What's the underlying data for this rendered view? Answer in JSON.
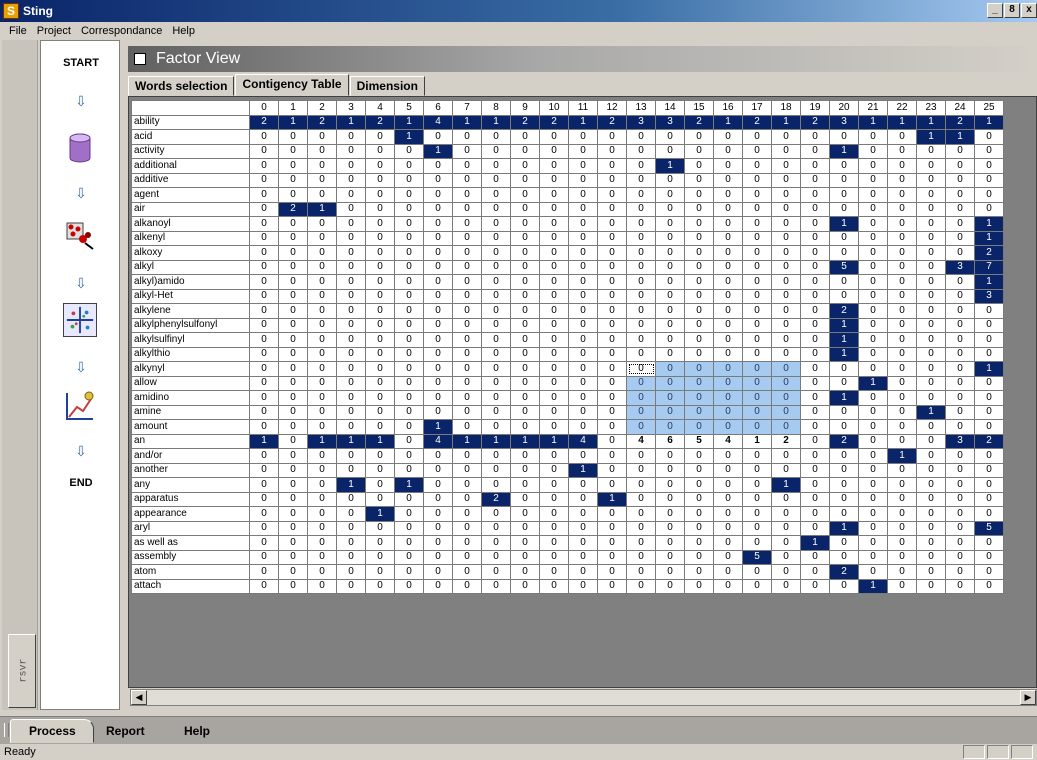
{
  "window": {
    "title": "Sting",
    "app_icon": "S",
    "minimize": "_",
    "restore": "8",
    "close": "x"
  },
  "menu": [
    "File",
    "Project",
    "Correspondance",
    "Help"
  ],
  "process": {
    "start": "START",
    "end": "END",
    "side_tab": "rsvr",
    "icons": [
      "database-icon",
      "sort-filter-icon",
      "factor-grid-icon",
      "chart-icon"
    ]
  },
  "factor_view": {
    "title": "Factor View"
  },
  "tabs": [
    {
      "label": "Words selection"
    },
    {
      "label": "Contigency Table",
      "active": true
    },
    {
      "label": "Dimension"
    }
  ],
  "table": {
    "columns": [
      "0",
      "1",
      "2",
      "3",
      "4",
      "5",
      "6",
      "7",
      "8",
      "9",
      "10",
      "11",
      "12",
      "13",
      "14",
      "15",
      "16",
      "17",
      "18",
      "19",
      "20",
      "21",
      "22",
      "23",
      "24",
      "25"
    ],
    "rows": [
      {
        "word": "ability",
        "values": [
          2,
          1,
          2,
          1,
          2,
          1,
          4,
          1,
          1,
          2,
          2,
          1,
          2,
          3,
          3,
          2,
          1,
          2,
          1,
          2,
          3,
          1,
          1,
          1,
          2,
          1
        ]
      },
      {
        "word": "acid",
        "values": [
          0,
          0,
          0,
          0,
          0,
          1,
          0,
          0,
          0,
          0,
          0,
          0,
          0,
          0,
          0,
          0,
          0,
          0,
          0,
          0,
          0,
          0,
          0,
          1,
          1,
          0
        ]
      },
      {
        "word": "activity",
        "values": [
          0,
          0,
          0,
          0,
          0,
          0,
          1,
          0,
          0,
          0,
          0,
          0,
          0,
          0,
          0,
          0,
          0,
          0,
          0,
          0,
          1,
          0,
          0,
          0,
          0,
          0
        ]
      },
      {
        "word": "additional",
        "values": [
          0,
          0,
          0,
          0,
          0,
          0,
          0,
          0,
          0,
          0,
          0,
          0,
          0,
          0,
          1,
          0,
          0,
          0,
          0,
          0,
          0,
          0,
          0,
          0,
          0,
          0
        ]
      },
      {
        "word": "additive",
        "values": [
          0,
          0,
          0,
          0,
          0,
          0,
          0,
          0,
          0,
          0,
          0,
          0,
          0,
          0,
          0,
          0,
          0,
          0,
          0,
          0,
          0,
          0,
          0,
          0,
          0,
          0
        ]
      },
      {
        "word": "agent",
        "values": [
          0,
          0,
          0,
          0,
          0,
          0,
          0,
          0,
          0,
          0,
          0,
          0,
          0,
          0,
          0,
          0,
          0,
          0,
          0,
          0,
          0,
          0,
          0,
          0,
          0,
          0
        ]
      },
      {
        "word": "air",
        "values": [
          0,
          2,
          1,
          0,
          0,
          0,
          0,
          0,
          0,
          0,
          0,
          0,
          0,
          0,
          0,
          0,
          0,
          0,
          0,
          0,
          0,
          0,
          0,
          0,
          0,
          0
        ]
      },
      {
        "word": "alkanoyl",
        "values": [
          0,
          0,
          0,
          0,
          0,
          0,
          0,
          0,
          0,
          0,
          0,
          0,
          0,
          0,
          0,
          0,
          0,
          0,
          0,
          0,
          1,
          0,
          0,
          0,
          0,
          1
        ]
      },
      {
        "word": "alkenyl",
        "values": [
          0,
          0,
          0,
          0,
          0,
          0,
          0,
          0,
          0,
          0,
          0,
          0,
          0,
          0,
          0,
          0,
          0,
          0,
          0,
          0,
          0,
          0,
          0,
          0,
          0,
          1
        ]
      },
      {
        "word": "alkoxy",
        "values": [
          0,
          0,
          0,
          0,
          0,
          0,
          0,
          0,
          0,
          0,
          0,
          0,
          0,
          0,
          0,
          0,
          0,
          0,
          0,
          0,
          0,
          0,
          0,
          0,
          0,
          2
        ]
      },
      {
        "word": "alkyl",
        "values": [
          0,
          0,
          0,
          0,
          0,
          0,
          0,
          0,
          0,
          0,
          0,
          0,
          0,
          0,
          0,
          0,
          0,
          0,
          0,
          0,
          5,
          0,
          0,
          0,
          3,
          7
        ]
      },
      {
        "word": "alkyl)amido",
        "values": [
          0,
          0,
          0,
          0,
          0,
          0,
          0,
          0,
          0,
          0,
          0,
          0,
          0,
          0,
          0,
          0,
          0,
          0,
          0,
          0,
          0,
          0,
          0,
          0,
          0,
          1
        ]
      },
      {
        "word": "alkyl-Het",
        "values": [
          0,
          0,
          0,
          0,
          0,
          0,
          0,
          0,
          0,
          0,
          0,
          0,
          0,
          0,
          0,
          0,
          0,
          0,
          0,
          0,
          0,
          0,
          0,
          0,
          0,
          3
        ]
      },
      {
        "word": "alkylene",
        "values": [
          0,
          0,
          0,
          0,
          0,
          0,
          0,
          0,
          0,
          0,
          0,
          0,
          0,
          0,
          0,
          0,
          0,
          0,
          0,
          0,
          2,
          0,
          0,
          0,
          0,
          0
        ]
      },
      {
        "word": "alkylphenylsulfonyl",
        "values": [
          0,
          0,
          0,
          0,
          0,
          0,
          0,
          0,
          0,
          0,
          0,
          0,
          0,
          0,
          0,
          0,
          0,
          0,
          0,
          0,
          1,
          0,
          0,
          0,
          0,
          0
        ]
      },
      {
        "word": "alkylsulfinyl",
        "values": [
          0,
          0,
          0,
          0,
          0,
          0,
          0,
          0,
          0,
          0,
          0,
          0,
          0,
          0,
          0,
          0,
          0,
          0,
          0,
          0,
          1,
          0,
          0,
          0,
          0,
          0
        ]
      },
      {
        "word": "alkylthio",
        "values": [
          0,
          0,
          0,
          0,
          0,
          0,
          0,
          0,
          0,
          0,
          0,
          0,
          0,
          0,
          0,
          0,
          0,
          0,
          0,
          0,
          1,
          0,
          0,
          0,
          0,
          0
        ]
      },
      {
        "word": "alkynyl",
        "values": [
          0,
          0,
          0,
          0,
          0,
          0,
          0,
          0,
          0,
          0,
          0,
          0,
          0,
          0,
          0,
          0,
          0,
          0,
          0,
          0,
          0,
          0,
          0,
          0,
          0,
          1
        ]
      },
      {
        "word": "allow",
        "values": [
          0,
          0,
          0,
          0,
          0,
          0,
          0,
          0,
          0,
          0,
          0,
          0,
          0,
          0,
          0,
          0,
          0,
          0,
          0,
          0,
          0,
          1,
          0,
          0,
          0,
          0
        ]
      },
      {
        "word": "amidino",
        "values": [
          0,
          0,
          0,
          0,
          0,
          0,
          0,
          0,
          0,
          0,
          0,
          0,
          0,
          0,
          0,
          0,
          0,
          0,
          0,
          0,
          1,
          0,
          0,
          0,
          0,
          0
        ]
      },
      {
        "word": "amine",
        "values": [
          0,
          0,
          0,
          0,
          0,
          0,
          0,
          0,
          0,
          0,
          0,
          0,
          0,
          0,
          0,
          0,
          0,
          0,
          0,
          0,
          0,
          0,
          0,
          1,
          0,
          0
        ]
      },
      {
        "word": "amount",
        "values": [
          0,
          0,
          0,
          0,
          0,
          0,
          1,
          0,
          0,
          0,
          0,
          0,
          0,
          0,
          0,
          0,
          0,
          0,
          0,
          0,
          0,
          0,
          0,
          0,
          0,
          0
        ]
      },
      {
        "word": "an",
        "values": [
          1,
          0,
          1,
          1,
          1,
          0,
          4,
          1,
          1,
          1,
          1,
          4,
          0,
          4,
          6,
          5,
          4,
          1,
          2,
          0,
          2,
          0,
          0,
          0,
          3,
          2
        ]
      },
      {
        "word": "and/or",
        "values": [
          0,
          0,
          0,
          0,
          0,
          0,
          0,
          0,
          0,
          0,
          0,
          0,
          0,
          0,
          0,
          0,
          0,
          0,
          0,
          0,
          0,
          0,
          1,
          0,
          0,
          0
        ]
      },
      {
        "word": "another",
        "values": [
          0,
          0,
          0,
          0,
          0,
          0,
          0,
          0,
          0,
          0,
          0,
          1,
          0,
          0,
          0,
          0,
          0,
          0,
          0,
          0,
          0,
          0,
          0,
          0,
          0,
          0
        ]
      },
      {
        "word": "any",
        "values": [
          0,
          0,
          0,
          1,
          0,
          1,
          0,
          0,
          0,
          0,
          0,
          0,
          0,
          0,
          0,
          0,
          0,
          0,
          1,
          0,
          0,
          0,
          0,
          0,
          0,
          0
        ]
      },
      {
        "word": "apparatus",
        "values": [
          0,
          0,
          0,
          0,
          0,
          0,
          0,
          0,
          2,
          0,
          0,
          0,
          1,
          0,
          0,
          0,
          0,
          0,
          0,
          0,
          0,
          0,
          0,
          0,
          0,
          0
        ]
      },
      {
        "word": "appearance",
        "values": [
          0,
          0,
          0,
          0,
          1,
          0,
          0,
          0,
          0,
          0,
          0,
          0,
          0,
          0,
          0,
          0,
          0,
          0,
          0,
          0,
          0,
          0,
          0,
          0,
          0,
          0
        ]
      },
      {
        "word": "aryl",
        "values": [
          0,
          0,
          0,
          0,
          0,
          0,
          0,
          0,
          0,
          0,
          0,
          0,
          0,
          0,
          0,
          0,
          0,
          0,
          0,
          0,
          1,
          0,
          0,
          0,
          0,
          5
        ]
      },
      {
        "word": "as well as",
        "values": [
          0,
          0,
          0,
          0,
          0,
          0,
          0,
          0,
          0,
          0,
          0,
          0,
          0,
          0,
          0,
          0,
          0,
          0,
          0,
          1,
          0,
          0,
          0,
          0,
          0,
          0
        ]
      },
      {
        "word": "assembly",
        "values": [
          0,
          0,
          0,
          0,
          0,
          0,
          0,
          0,
          0,
          0,
          0,
          0,
          0,
          0,
          0,
          0,
          0,
          5,
          0,
          0,
          0,
          0,
          0,
          0,
          0,
          0
        ]
      },
      {
        "word": "atom",
        "values": [
          0,
          0,
          0,
          0,
          0,
          0,
          0,
          0,
          0,
          0,
          0,
          0,
          0,
          0,
          0,
          0,
          0,
          0,
          0,
          0,
          2,
          0,
          0,
          0,
          0,
          0
        ]
      },
      {
        "word": "attach",
        "values": [
          0,
          0,
          0,
          0,
          0,
          0,
          0,
          0,
          0,
          0,
          0,
          0,
          0,
          0,
          0,
          0,
          0,
          0,
          0,
          0,
          0,
          1,
          0,
          0,
          0,
          0
        ]
      }
    ]
  },
  "bottom_tabs": [
    {
      "label": "Process",
      "active": true
    },
    {
      "label": "Report"
    },
    {
      "label": "Help"
    }
  ],
  "status": {
    "text": "Ready"
  },
  "colors": {
    "highlight": "#0a246a",
    "selection": "#a6caf0"
  }
}
